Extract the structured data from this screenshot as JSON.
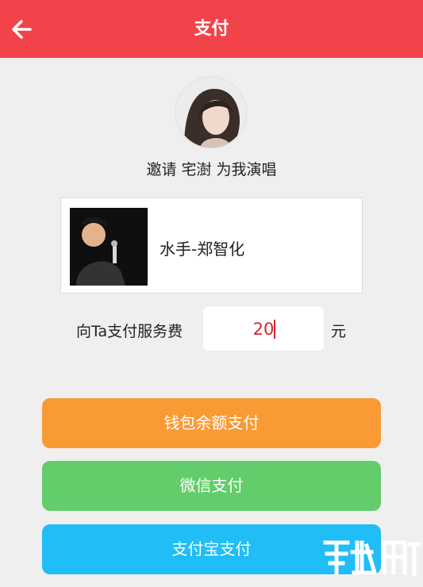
{
  "header": {
    "title": "支付"
  },
  "invite": {
    "text": "邀请 宅澍 为我演唱"
  },
  "song": {
    "title": "水手-郑智化"
  },
  "payment": {
    "label": "向Ta支付服务费",
    "amount": "20",
    "unit": "元"
  },
  "buttons": {
    "wallet": "钱包余额支付",
    "wechat": "微信支付",
    "alipay": "支付宝支付"
  },
  "colors": {
    "header": "#f2434a",
    "wallet_button": "#f99a35",
    "wechat_button": "#62cd6a",
    "alipay_button": "#20bdf7",
    "amount_text": "#d9232f"
  },
  "icons": {
    "back": "arrow-left-icon",
    "watermark": "watermark-logo"
  }
}
